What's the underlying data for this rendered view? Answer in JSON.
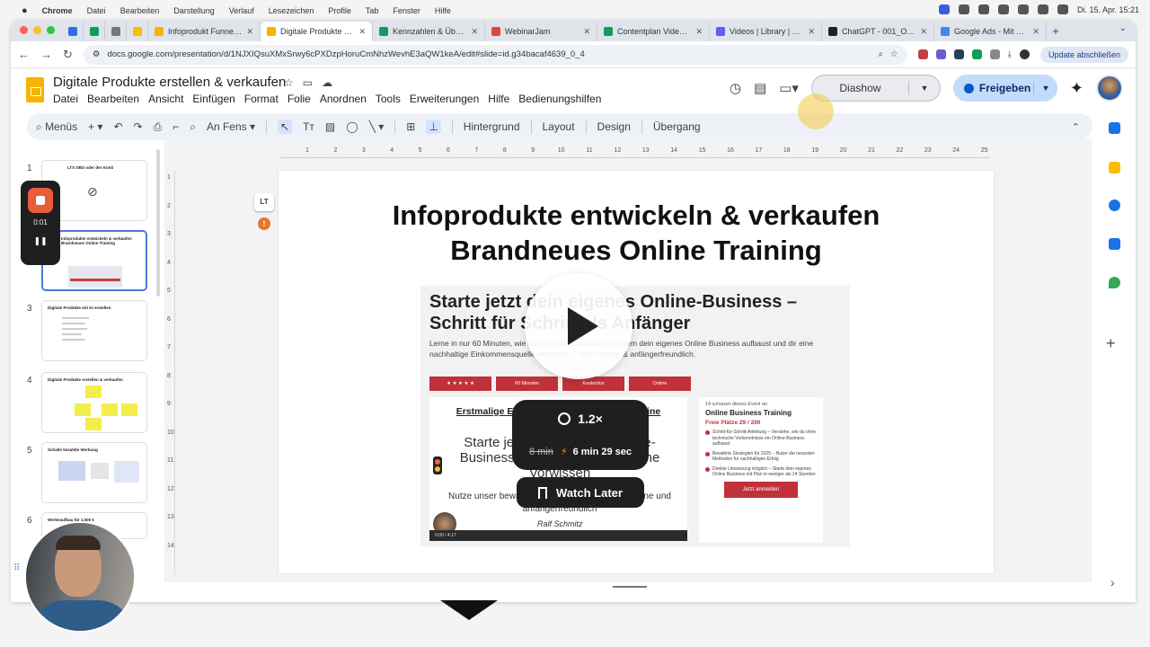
{
  "mac_menu": {
    "items": [
      "Chrome",
      "Datei",
      "Bearbeiten",
      "Darstellung",
      "Verlauf",
      "Lesezeichen",
      "Profile",
      "Tab",
      "Fenster",
      "Hilfe"
    ],
    "datetime": "Di. 15. Apr. 15:21"
  },
  "browser": {
    "tabs": [
      {
        "title": "Infoprodukt Funnel ka",
        "color": "#f4b400"
      },
      {
        "title": "Digitale Produkte erste",
        "color": "#f4b400",
        "active": true
      },
      {
        "title": "Kennzahlen & Übersich",
        "color": "#0f9d58"
      },
      {
        "title": "WebinarJam",
        "color": "#d44"
      },
      {
        "title": "Contentplan Videos So",
        "color": "#0f9d58"
      },
      {
        "title": "Videos | Library | Loom",
        "color": "#625df5"
      },
      {
        "title": "ChatGPT - 001_OBS_",
        "color": "#222"
      },
      {
        "title": "Google Ads - Mit Onlin",
        "color": "#4285f4"
      }
    ],
    "url": "docs.google.com/presentation/d/1NJXIQsuXMxSrwy6cPXDzpHoruCmNhzWevhE3aQW1keA/edit#slide=id.g34bacaf4639_0_4",
    "update_button": "Update abschließen"
  },
  "doc": {
    "title": "Digitale Produkte erstellen & verkaufen",
    "menu": [
      "Datei",
      "Bearbeiten",
      "Ansicht",
      "Einfügen",
      "Format",
      "Folie",
      "Anordnen",
      "Tools",
      "Erweiterungen",
      "Hilfe",
      "Bedienungshilfen"
    ],
    "slideshow_label": "Diashow",
    "share_label": "Freigeben"
  },
  "edit_toolbar": {
    "menus_label": "Menüs",
    "zoom_label": "An Fens",
    "text_items": [
      "Hintergrund",
      "Layout",
      "Design",
      "Übergang"
    ]
  },
  "filmstrip": {
    "slides": [
      {
        "num": "1",
        "title": "LTX OBS oder der Konti"
      },
      {
        "num": "2",
        "title": "Infoprodukte entwickeln & verkaufen Brandneues Online Training"
      },
      {
        "num": "3",
        "title": "Digitale Produkte mit KI erstellen"
      },
      {
        "num": "4",
        "title": "Digitale Produkte erstellen & verkaufen"
      },
      {
        "num": "5",
        "title": "Schalte bezahlte Werbung"
      },
      {
        "num": "6",
        "title": "Werbeaufbau für 1.000 €"
      }
    ]
  },
  "recorder": {
    "time": "0:01"
  },
  "ruler": {
    "h": [
      "1",
      "2",
      "3",
      "4",
      "5",
      "6",
      "7",
      "8",
      "9",
      "10",
      "11",
      "12",
      "13",
      "14",
      "15",
      "16",
      "17",
      "18",
      "19",
      "20",
      "21",
      "22",
      "23",
      "24",
      "25"
    ],
    "v": [
      "1",
      "2",
      "3",
      "4",
      "5",
      "6",
      "7",
      "8",
      "9",
      "10",
      "11",
      "12",
      "13",
      "14"
    ]
  },
  "slide": {
    "title_line1": "Infoprodukte entwickeln & verkaufen",
    "title_line2": "Brandneues Online Training",
    "shot": {
      "headline": "Starte jetzt dein eigenes Online-Business – Schritt für Schritt als Anfänger",
      "paragraph": "Lerne in nur 60 Minuten, wie du mit einem bewährten System dein eigenes Online Business aufbaust und dir eine nachhaltige Einkommensquelle erschaffst – 100% online & anfängerfreundlich.",
      "badges": [
        "★ ★ ★ ★ ★",
        "60 Minuten",
        "Kostenlos",
        "Online"
      ],
      "video_title": "Erstmalige Enthüllung: Das Geheimnis online",
      "video_big": "Starte jetzt dein eigenes Online-Business - Schritt für Schritt ohne Vorwissen",
      "video_sub": "Nutze unser bewährtes System, für Einsteiger ohne und anfängerfreundlich",
      "author": "Ralf Schmitz",
      "player_bar": "0:00 / 4:17",
      "side": {
        "watching": "14 schauen dieses Event an",
        "event": "Online Business Training",
        "seats": "Freie Plätze 29 / 200",
        "items": [
          "Schritt-für-Schritt-Anleitung – Verstehe, wie du ohne technische Vorkenntnisse ein Online-Business aufbaust",
          "Bewährte Strategien für 2025 – Nutze die neuesten Methoden für nachhaltigen Erfolg",
          "Direkte Umsetzung möglich – Starte dein eigenes Online Business mit Plan in weniger als 24 Stunden"
        ],
        "button": "Jetzt anmelden"
      }
    }
  },
  "video_overlay": {
    "speed": "1.2×",
    "original_time": "8 min",
    "new_time": "6 min 29 sec",
    "watch_later": "Watch Later"
  },
  "colors": {
    "accent": "#c0313a",
    "slides_yellow": "#f4b400",
    "share_blue": "#c2dcf9"
  }
}
